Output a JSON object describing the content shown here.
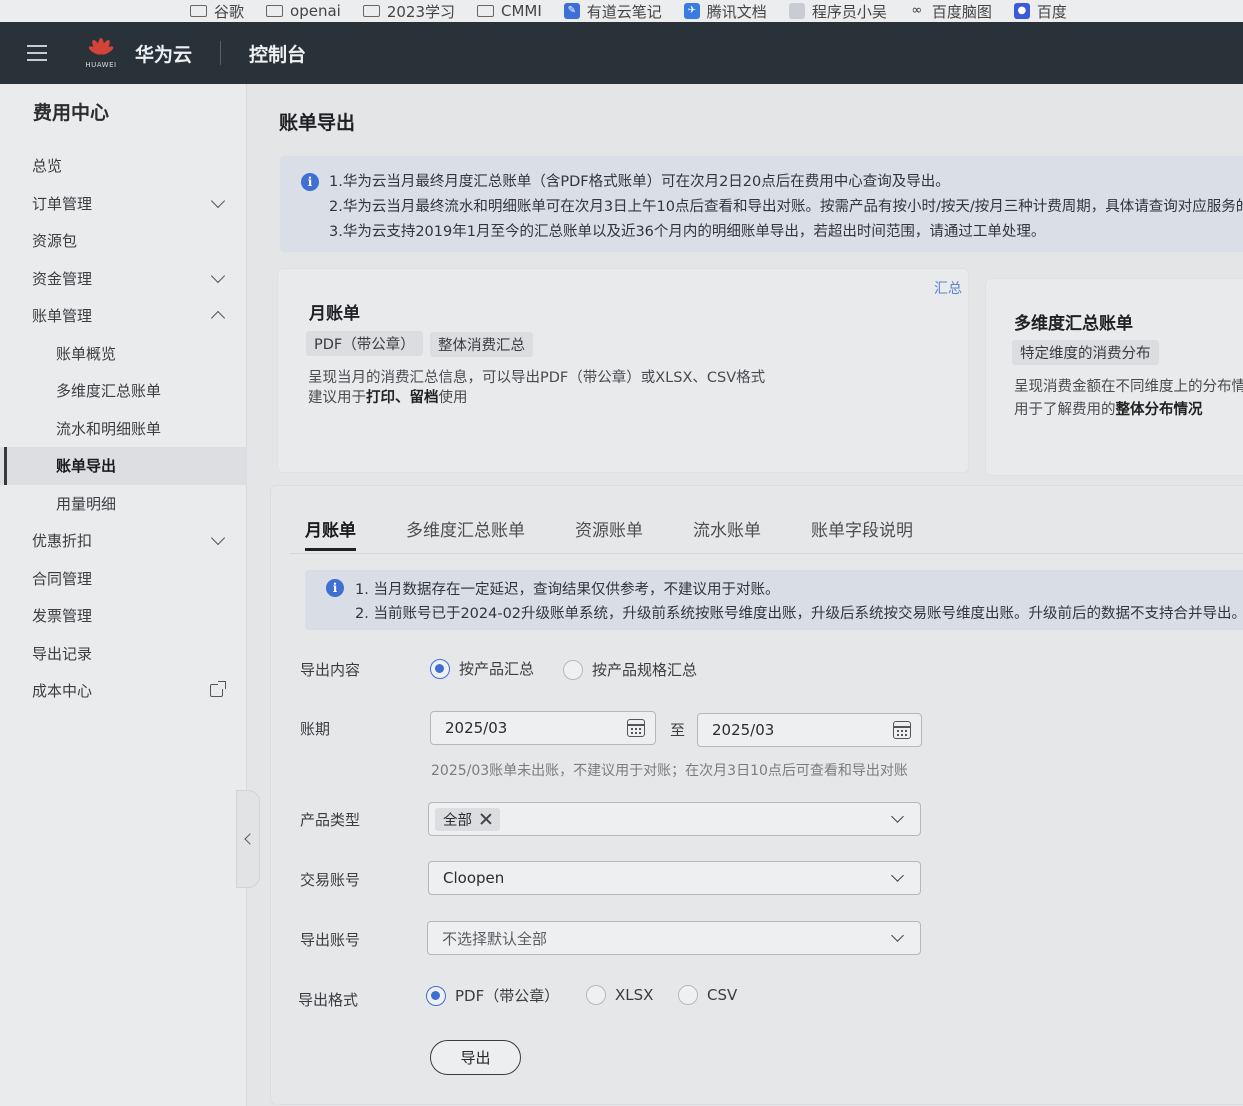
{
  "bookmarks": [
    {
      "label": "谷歌",
      "icon": "folder-icon"
    },
    {
      "label": "openai",
      "icon": "folder-icon"
    },
    {
      "label": "2023学习",
      "icon": "folder-icon"
    },
    {
      "label": "CMMI",
      "icon": "folder-icon"
    },
    {
      "label": "有道云笔记",
      "icon": "youdao-note-icon"
    },
    {
      "label": "腾讯文档",
      "icon": "tencent-docs-icon"
    },
    {
      "label": "程序员小吴",
      "icon": "bookmark-page-icon"
    },
    {
      "label": "百度脑图",
      "icon": "baidu-mindmap-icon"
    },
    {
      "label": "百度",
      "icon": "baidu-paw-icon"
    }
  ],
  "header": {
    "logo_text": "HUAWEI",
    "brand": "华为云",
    "console": "控制台"
  },
  "sidebar": {
    "title": "费用中心",
    "items": [
      {
        "label": "总览",
        "type": "plain"
      },
      {
        "label": "订单管理",
        "type": "expand"
      },
      {
        "label": "资源包",
        "type": "plain"
      },
      {
        "label": "资金管理",
        "type": "expand"
      },
      {
        "label": "账单管理",
        "type": "collapse"
      },
      {
        "label": "账单概览",
        "type": "sub"
      },
      {
        "label": "多维度汇总账单",
        "type": "sub"
      },
      {
        "label": "流水和明细账单",
        "type": "sub"
      },
      {
        "label": "账单导出",
        "type": "sub-active"
      },
      {
        "label": "用量明细",
        "type": "sub"
      },
      {
        "label": "优惠折扣",
        "type": "expand"
      },
      {
        "label": "合同管理",
        "type": "plain"
      },
      {
        "label": "发票管理",
        "type": "plain"
      },
      {
        "label": "导出记录",
        "type": "plain"
      },
      {
        "label": "成本中心",
        "type": "external"
      }
    ]
  },
  "main": {
    "page_title": "账单导出",
    "notice_top": [
      "1.华为云当月最终月度汇总账单（含PDF格式账单）可在次月2日20点后在费用中心查询及导出。",
      "2.华为云当月最终流水和明细账单可在次月3日上午10点后查看和导出对账。按需产品有按小时/按天/按月三种计费周期，具体请查询对应服务的",
      "3.华为云支持2019年1月至今的汇总账单以及近36个月内的明细账单导出，若超出时间范围，请通过工单处理。"
    ],
    "card_monthly": {
      "badge": "汇总",
      "title": "月账单",
      "tags": [
        "PDF（带公章）",
        "整体消费汇总"
      ],
      "desc_line1": "呈现当月的消费汇总信息，可以导出PDF（带公章）或XLSX、CSV格式",
      "desc_line2_prefix": "建议用于",
      "desc_line2_bold": "打印、留档",
      "desc_line2_suffix": "使用"
    },
    "card_multi": {
      "title": "多维度汇总账单",
      "tag": "特定维度的消费分布",
      "desc_line1": "呈现消费金额在不同维度上的分布情",
      "desc_line2_prefix": "用于了解费用的",
      "desc_line2_bold": "整体分布情况"
    },
    "tabs": [
      "月账单",
      "多维度汇总账单",
      "资源账单",
      "流水账单",
      "账单字段说明"
    ],
    "notice_tab": [
      "1. 当月数据存在一定延迟，查询结果仅供参考，不建议用于对账。",
      "2. 当前账号已于2024-02升级账单系统，升级前系统按账号维度出账，升级后系统按交易账号维度出账。升级前后的数据不支持合并导出。"
    ],
    "form": {
      "export_content_label": "导出内容",
      "export_content_options": [
        "按产品汇总",
        "按产品规格汇总"
      ],
      "period_label": "账期",
      "period_start": "2025/03",
      "period_sep": "至",
      "period_end": "2025/03",
      "period_hint": "2025/03账单未出账，不建议用于对账；在次月3日10点后可查看和导出对账",
      "product_type_label": "产品类型",
      "product_type_chip": "全部",
      "trade_account_label": "交易账号",
      "trade_account_value": "Cloopen",
      "export_account_label": "导出账号",
      "export_account_placeholder": "不选择默认全部",
      "format_label": "导出格式",
      "format_options": [
        "PDF（带公章）",
        "XLSX",
        "CSV"
      ],
      "export_button": "导出"
    }
  },
  "colors": {
    "header_bg": "#283238",
    "accent_blue": "#3d6ed1",
    "notice_bg": "#dadee6"
  }
}
